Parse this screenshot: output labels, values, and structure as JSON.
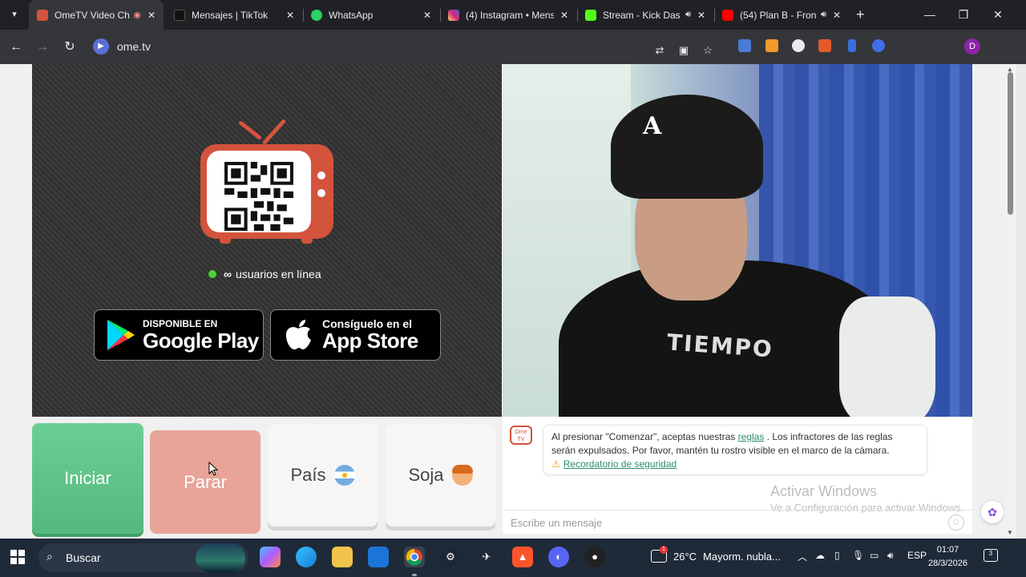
{
  "browser": {
    "tabs": [
      {
        "title": "OmeTV Video Ch",
        "active": true,
        "favicon_color": "#d4533c",
        "recording": true
      },
      {
        "title": "Mensajes | TikTok",
        "favicon_color": "#111111"
      },
      {
        "title": "WhatsApp",
        "favicon_color": "#25d366"
      },
      {
        "title": "(4) Instagram • Mens",
        "favicon_color": "#dd2a7b"
      },
      {
        "title": "Stream - Kick Das",
        "favicon_color": "#53fc18",
        "audio": true
      },
      {
        "title": "(54) Plan B - Fron",
        "favicon_color": "#ff0000",
        "audio": true
      }
    ],
    "new_tab_label": "+",
    "url": "ome.tv",
    "profile_initial": "D"
  },
  "page": {
    "online_count": "∞",
    "online_label": "usuarios en línea",
    "google_play": {
      "small": "DISPONIBLE EN",
      "big": "Google Play"
    },
    "app_store": {
      "small": "Consíguelo en el",
      "big": "App Store"
    },
    "camera_cap_logo": "A",
    "camera_shirt_print": "TIEMPO"
  },
  "controls": {
    "start_label": "Iniciar",
    "stop_label": "Parar",
    "country_label": "País",
    "gender_label": "Soja"
  },
  "chat": {
    "logo_text": "Ome TV",
    "notice_before_link": "Al presionar \"Comenzar\", aceptas nuestras ",
    "notice_link": "reglas",
    "notice_after_link": " . Los infractores de las reglas serán expulsados. Por favor, mantén tu rostro visible en el marco de la cámara.",
    "safety_link": "Recordatorio de seguridad",
    "input_placeholder": "Escribe un mensaje",
    "watermark_title": "Activar Windows",
    "watermark_subtitle": "Ve a Configuración para activar Windows."
  },
  "taskbar": {
    "search_label": "Buscar",
    "weather_alert_count": "1",
    "weather_temp": "26°C",
    "weather_desc": "Mayorm. nubla...",
    "language": "ESP",
    "time": "01:07",
    "date": "28/3/2026",
    "notification_count": "3"
  }
}
